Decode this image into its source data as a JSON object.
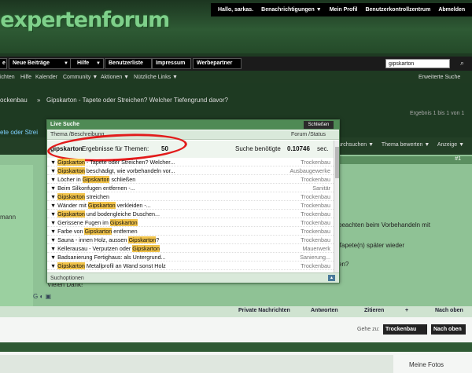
{
  "header": {
    "logo_text": "uexpertenforum",
    "top_links": [
      "Hallo, sarkas.",
      "Benachrichtigungen ▼",
      "Mein Profil",
      "Benutzerkontrollzentrum",
      "Abmelden"
    ]
  },
  "nav": {
    "items": [
      "e",
      "Neue Beiträge",
      "Hilfe",
      "Benutzerliste",
      "Impressum",
      "Werbepartner"
    ],
    "search_value": "gipskarton",
    "sub_links": [
      "ichten",
      "Hilfe",
      "Kalender",
      "Community ▼",
      "Aktionen ▼",
      "Nützliche Links ▼"
    ],
    "advanced_search": "Erweiterte Suche"
  },
  "breadcrumb": {
    "section": "ockenbau",
    "title": "Gipskarton - Tapete oder Streichen? Welcher Tiefengrund davor?",
    "results": "Ergebnis 1 bis 1 von 1",
    "partial": "ete oder Strei"
  },
  "thread_tools": [
    "urchsuchen ▼",
    "Thema bewerten ▼",
    "Anzeige ▼"
  ],
  "post": {
    "number": "#1",
    "left_fragment": "mann",
    "text_fragments": [
      "beachten beim Vorbehandeln mit",
      "Tapete(n) später wieder",
      "en?"
    ],
    "thanks": "Vielen Dank!",
    "actions": [
      "Private Nachrichten",
      "Antworten",
      "Zitieren",
      "+",
      "Nach oben"
    ]
  },
  "footer": {
    "goto_label": "Gehe zu:",
    "goto_value": "Trockenbau",
    "top_button": "Nach oben",
    "meine_fotos": "Meine Fotos"
  },
  "popup": {
    "title": "Live Suche",
    "close": "Schließen",
    "col_thread": "Thema /Beschreibung",
    "col_forum": "Forum /Status",
    "query": "gipskarton",
    "results_label": "Ergebnisse für Themen:",
    "results_count": "50",
    "time_label": "Suche benötigte",
    "time_value": "0.10746",
    "time_unit": "sec.",
    "footer": "Suchoptionen",
    "rows": [
      {
        "pre": "",
        "hl": "Gipskarton",
        "post": " - Tapete oder Streichen? Welcher...",
        "forum": "Trockenbau"
      },
      {
        "pre": "",
        "hl": "Gipskarton",
        "post": " beschädigt, wie vorbehandeln vor...",
        "forum": "Ausbaugewerke"
      },
      {
        "pre": "Löcher in ",
        "hl": "Gipskarton",
        "post": " schließen",
        "forum": "Trockenbau"
      },
      {
        "pre": "Beim Silkonfugen entfernen -...",
        "hl": "",
        "post": "",
        "forum": "Sanitär"
      },
      {
        "pre": "",
        "hl": "Gipskarton",
        "post": " streichen",
        "forum": "Trockenbau"
      },
      {
        "pre": "Wänder mit ",
        "hl": "Gipskarton",
        "post": " verkleiden -...",
        "forum": "Trockenbau"
      },
      {
        "pre": "",
        "hl": "Gipskarton",
        "post": " und bodengleiche Duschen...",
        "forum": "Trockenbau"
      },
      {
        "pre": "Gerissene Fugen im ",
        "hl": "Gipskarton",
        "post": "",
        "forum": "Trockenbau"
      },
      {
        "pre": "Farbe von ",
        "hl": "Gipskarton",
        "post": " entfernen",
        "forum": "Trockenbau"
      },
      {
        "pre": "Sauna - innen Holz, aussen ",
        "hl": "Gipskarton",
        "post": "?",
        "forum": "Trockenbau"
      },
      {
        "pre": "Kellerausau - Verputzen oder ",
        "hl": "Gipskarton",
        "post": "",
        "forum": "Mauerwerk"
      },
      {
        "pre": "Badsanierung Fertighaus: als Untergrund...",
        "hl": "",
        "post": "",
        "forum": "Sanierung..."
      },
      {
        "pre": "",
        "hl": "Gipskarton",
        "post": " Metallprofil an Wand sonst Holz",
        "forum": "Trockenbau"
      }
    ]
  }
}
